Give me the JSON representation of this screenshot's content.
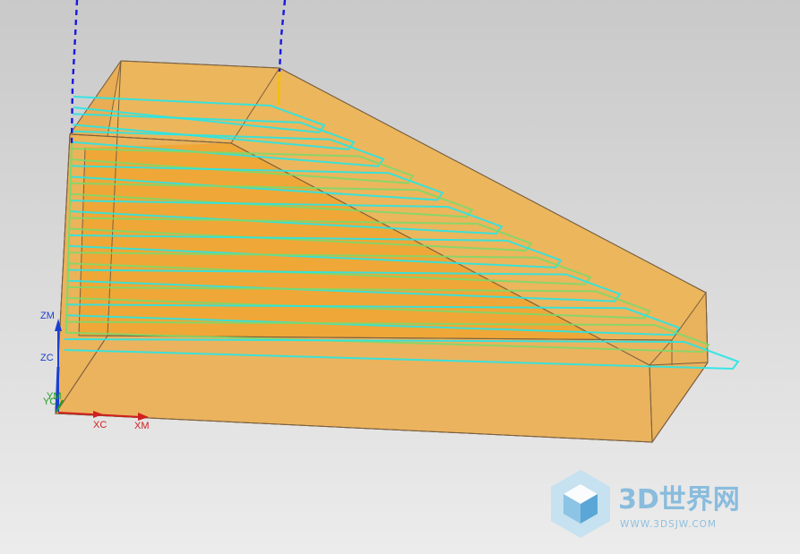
{
  "viewport": {
    "background_top": "#c9c9c9",
    "background_bottom": "#ececec"
  },
  "model": {
    "face_color": "#ecb65c",
    "inner_face_color": "#f0a531",
    "edge_color": "#7a6040"
  },
  "toolpath": {
    "cut_color": "#27e6e6",
    "engage_color": "#7fd86a",
    "rapid_color": "#1818e0",
    "feed_color": "#f5c000"
  },
  "triad": {
    "zm": "ZM",
    "zc": "ZC",
    "yc": "YC",
    "ym": "YM",
    "xc": "XC",
    "xm": "XM",
    "z_color": "#1a3fd0",
    "x_color": "#d02020",
    "y_color": "#20a020"
  },
  "watermark": {
    "title": "3D世界网",
    "url": "WWW.3DSJW.COM",
    "color": "#7fb8dc"
  }
}
